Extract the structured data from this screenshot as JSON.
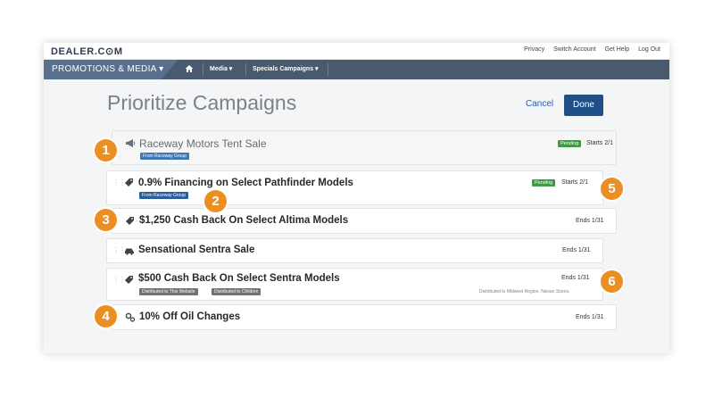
{
  "topbar": {
    "logo": "DEALER.C⊙M",
    "links": [
      "Privacy",
      "Switch Account",
      "Get Help",
      "Log Out"
    ]
  },
  "nav": {
    "brand": "PROMOTIONS & MEDIA ▾",
    "home_icon": "home-icon",
    "items": [
      "Media ▾",
      "Specials Campaigns ▾"
    ]
  },
  "page": {
    "title": "Prioritize Campaigns",
    "cancel_label": "Cancel",
    "done_label": "Done"
  },
  "campaigns": [
    {
      "icon": "megaphone-icon",
      "title": "Raceway Motors Tent Sale",
      "tags": [
        "From Raceway Group"
      ],
      "pending": "Pending",
      "status": "Starts 2/1"
    },
    {
      "icon": "tag-icon",
      "title": "0.9% Financing on Select Pathfinder Models",
      "tags": [
        "From Raceway Group"
      ],
      "pending": "Pending",
      "status": "Starts 2/1"
    },
    {
      "icon": "tag-icon",
      "title": "$1,250 Cash Back On Select Altima Models",
      "status": "Ends 1/31"
    },
    {
      "icon": "car-icon",
      "title": "Sensational Sentra Sale",
      "status": "Ends 1/31"
    },
    {
      "icon": "tag-icon",
      "title": "$500 Cash Back On Select Sentra Models",
      "tags": [
        "Distributed to This Website",
        "Distributed to Children"
      ],
      "status": "Ends 1/31",
      "distribution": "Distributed to Midwest Region, Nissan Stores."
    },
    {
      "icon": "gears-icon",
      "title": "10% Off Oil Changes",
      "status": "Ends 1/31"
    }
  ],
  "callouts": [
    "1",
    "2",
    "3",
    "4",
    "5",
    "6"
  ],
  "colors": {
    "accent": "#ec8f22",
    "nav": "#495a6f",
    "done": "#1f4f86",
    "pending": "#3f9a45"
  }
}
